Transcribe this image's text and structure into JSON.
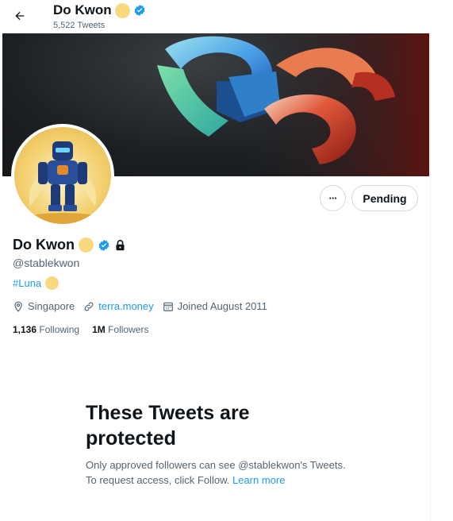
{
  "header": {
    "name": "Do Kwon",
    "tweet_count": "5,522 Tweets"
  },
  "profile": {
    "name": "Do Kwon",
    "handle": "@stablekwon",
    "bio_hashtag": "#Luna",
    "location": "Singapore",
    "website": "terra.money",
    "joined": "Joined August 2011",
    "following_count": "1,136",
    "following_label": "Following",
    "followers_count": "1M",
    "followers_label": "Followers"
  },
  "actions": {
    "pending_label": "Pending",
    "more_label": "···"
  },
  "protected": {
    "title": "These Tweets are protected",
    "message": "Only approved followers can see @stablekwon's Tweets. To request access, click Follow.",
    "link_text": "Learn more"
  },
  "colors": {
    "accent": "#1d9bf0",
    "moon": "#f8d980",
    "secondary_text": "#536471"
  },
  "icons": {
    "back": "arrow-left-icon",
    "verified": "verified-badge-icon",
    "lock": "lock-icon",
    "location": "location-pin-icon",
    "link": "link-icon",
    "calendar": "calendar-icon"
  }
}
